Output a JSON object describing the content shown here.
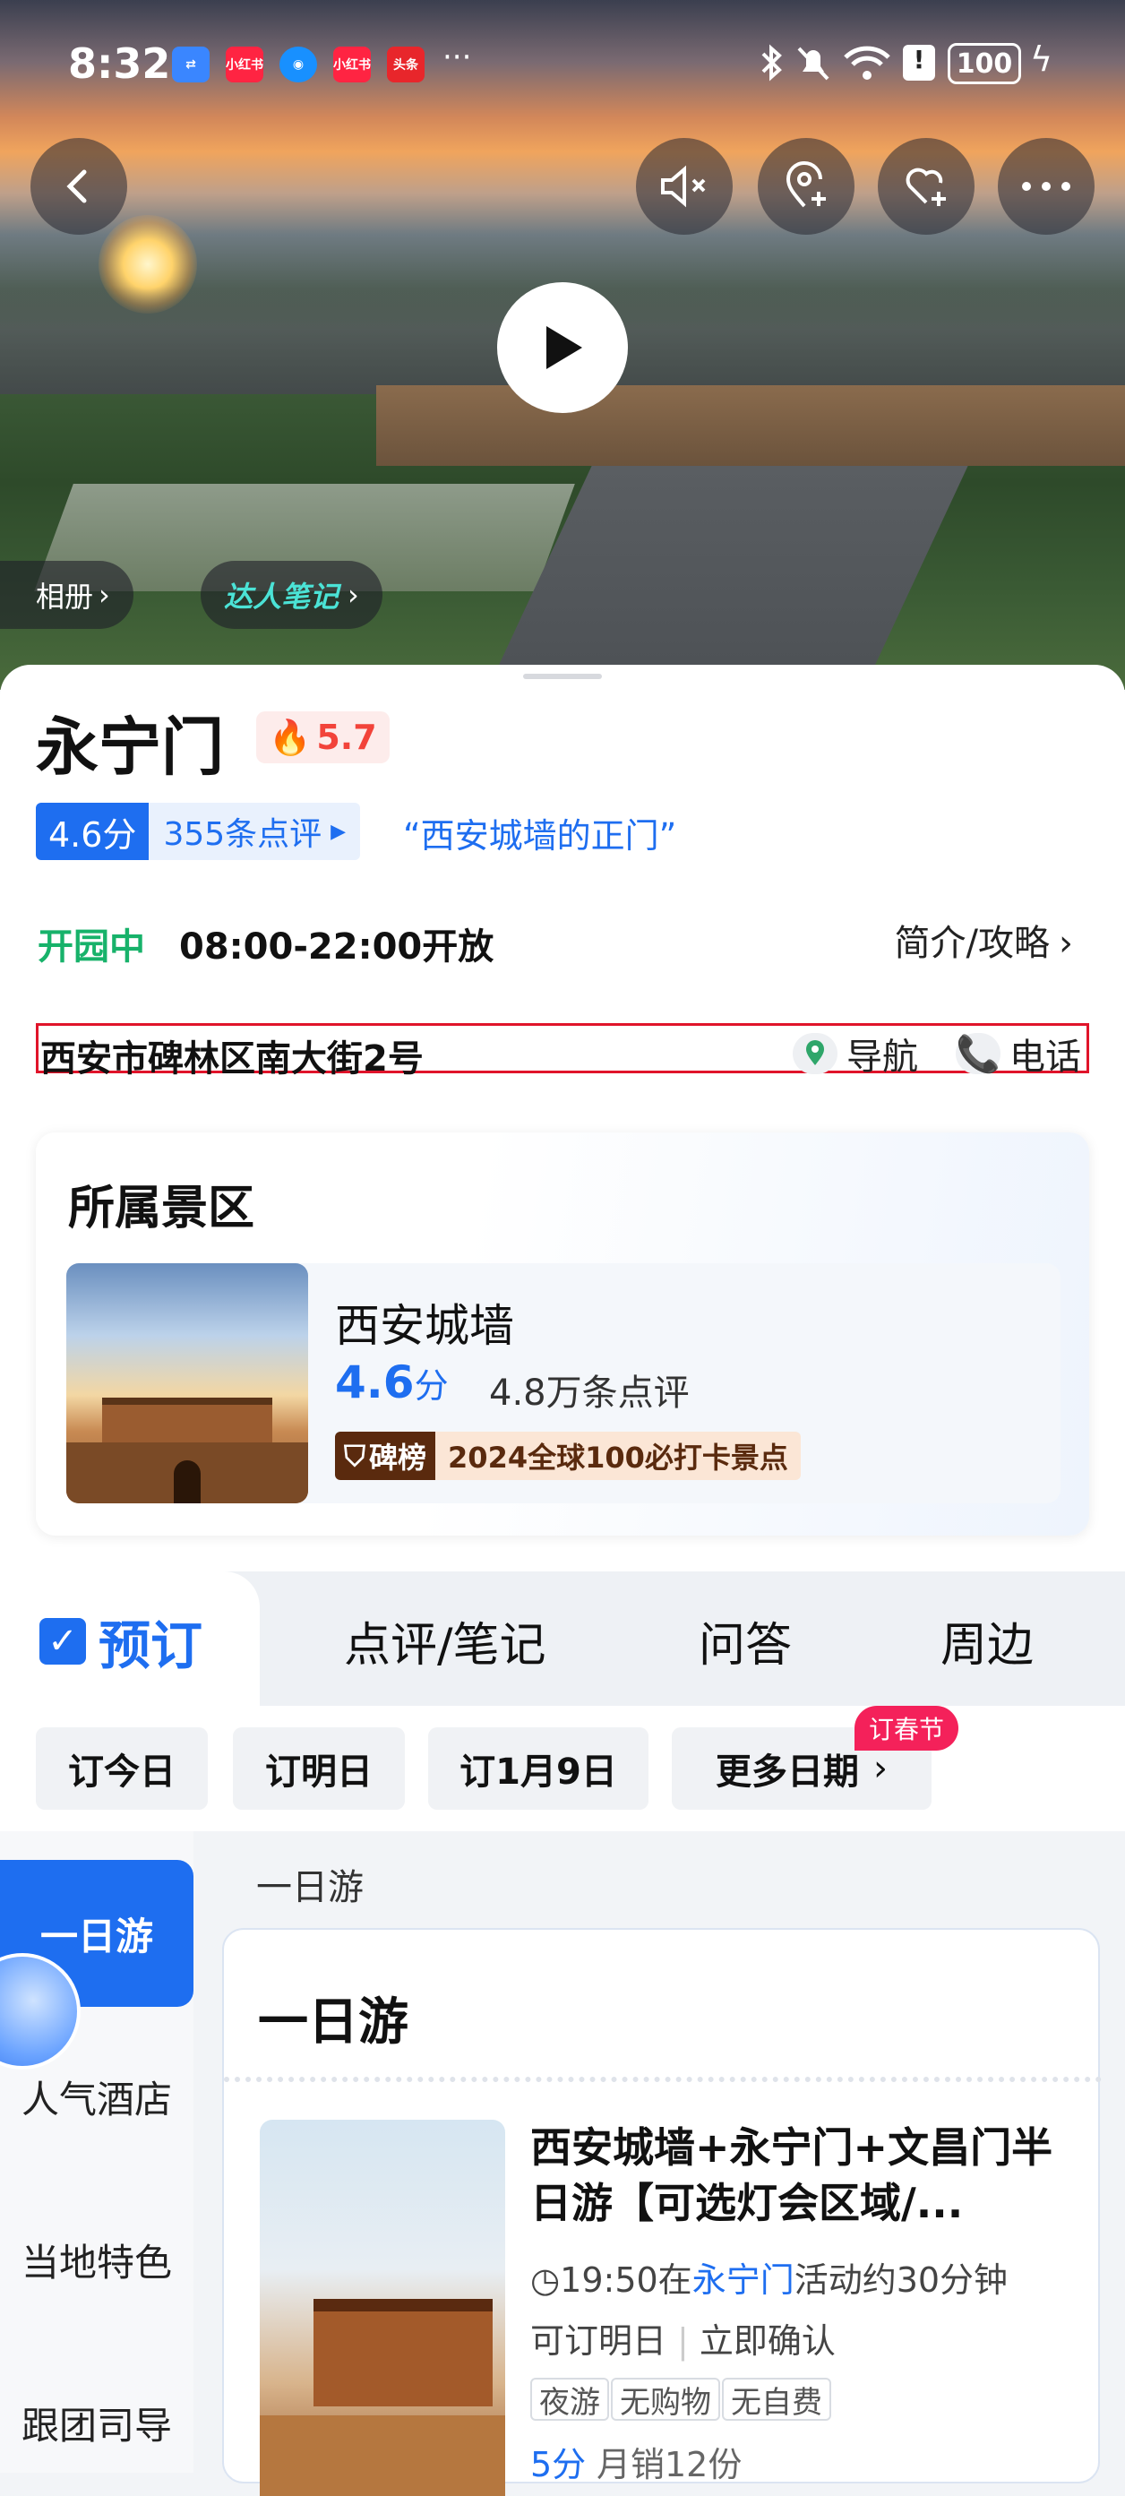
{
  "status_bar": {
    "time": "8:32",
    "apps": [
      "小红书",
      "小红书",
      "头条"
    ],
    "more": "···",
    "battery": "100"
  },
  "hero": {
    "album_label": "相册",
    "notes_label": "达人笔记"
  },
  "poi": {
    "name": "永宁门",
    "heat": "5.7",
    "score": "4.6分",
    "reviews": "355条点评",
    "quote": "“西安城墙的正门”",
    "open_status": "开园中",
    "hours": "08:00-22:00开放",
    "guide_label": "简介/攻略",
    "address": "西安市碑林区南大街2号",
    "nav_label": "导航",
    "phone_label": "电话"
  },
  "scenic_area": {
    "heading": "所属景区",
    "name": "西安城墙",
    "score_num": "4.6",
    "score_unit": "分",
    "reviews": "4.8万条点评",
    "rank_tag": "碑榜",
    "rank_text": "2024全球100必打卡景点"
  },
  "tabs": [
    "预订",
    "点评/笔记",
    "问答",
    "周边"
  ],
  "date_chips": [
    "订今日",
    "订明日",
    "订1月9日",
    "更多日期"
  ],
  "festival_badge": "订春节",
  "side_menu": [
    "一日游",
    "人气酒店",
    "当地特色",
    "跟团司导"
  ],
  "section_subhead": "一日游",
  "product_list": {
    "heading": "一日游",
    "title": "西安城墙+永宁门+文昌门半日游【可选灯会区域/...",
    "time_prefix": "19:50在",
    "time_place": "永宁门",
    "time_suffix": "活动约30分钟",
    "bookable": "可订明日",
    "confirm": "立即确认",
    "tags": [
      "夜游",
      "无购物",
      "无自费"
    ],
    "score": "5分",
    "sold": "月销12份"
  },
  "colors": {
    "accent": "#1e6ef0",
    "open_green": "#17b26a",
    "heat_red": "#f2433a",
    "highlight_border": "#e0142a"
  }
}
